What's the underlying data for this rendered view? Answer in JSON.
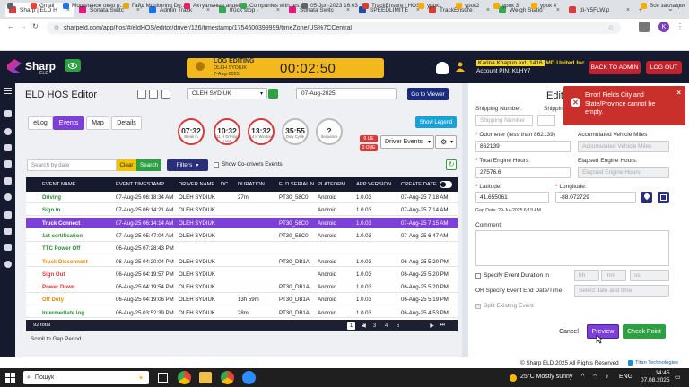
{
  "browser": {
    "tabs": [
      {
        "label": "Sharp | ELD H",
        "active": true,
        "color": "#d73b3b"
      },
      {
        "label": "Sonata Switc",
        "color": "#e31b7c"
      },
      {
        "label": "Admin Track",
        "color": "#1a73e8"
      },
      {
        "label": "truck stop -",
        "color": "#34a853"
      },
      {
        "label": "Sonata Switc",
        "color": "#e31b7c"
      },
      {
        "label": "SPEEDLIMITE",
        "color": "#1f4ea8"
      },
      {
        "label": "TrackEnsure |",
        "color": "#d23f31"
      },
      {
        "label": "Weigh Statio",
        "color": "#34a853"
      },
      {
        "label": "di-Y5FLW.p",
        "color": "#d73b3b"
      }
    ],
    "url": "sharpeld.com/app/hos/#/eldHOS/editor/driver/126/timestamp/1754600399999/timeZone/US%7CCentral",
    "bookmarks": [
      {
        "label": "Gmail",
        "color": "#ea4335"
      },
      {
        "label": "Модальное окно р...",
        "color": "#1a73e8"
      },
      {
        "label": "Гайд Monitoring De...",
        "color": "#e8a317"
      },
      {
        "label": "Актуальные апдейт...",
        "color": "#e91e63"
      },
      {
        "label": "Companies with res...",
        "color": "#34a853"
      },
      {
        "label": "05-Jun-2023 16:03",
        "color": "#5f6368"
      },
      {
        "label": "TrackEnsure | HOS",
        "color": "#d23f31"
      },
      {
        "label": "урок1",
        "color": "#f9ab00"
      },
      {
        "label": "урок2",
        "color": "#f9ab00"
      },
      {
        "label": "урок 3",
        "color": "#f9ab00"
      },
      {
        "label": "урок 4",
        "color": "#f9ab00"
      },
      {
        "label": "Все закладки",
        "color": "#f9ab00"
      }
    ]
  },
  "header": {
    "logo_text": "Sharp",
    "logo_sub": "ELD",
    "timer_title": "LOG EDITING",
    "timer_l1": "OLEH SYDIUK",
    "timer_l2": "7-Aug-2025",
    "timer_value": "00:02:50",
    "user_name": "Karina Khapun ext. 1416",
    "company": "MD United Inc",
    "account_pin": "Account PIN: KLHY7",
    "back_admin": "BACK TO ADMIN",
    "logout": "LOG OUT"
  },
  "editor": {
    "title": "ELD HOS Editor",
    "driver": "OLEH SYDIUK",
    "date": "07-Aug-2025",
    "goto_viewer": "Go to Viewer",
    "tabs": [
      "eLog",
      "Events",
      "Map",
      "Details"
    ],
    "active_tab": "Events",
    "clocks": [
      {
        "time": "07:32",
        "label": "Break in"
      },
      {
        "time": "10:32",
        "label": "11 H Driving Limit"
      },
      {
        "time": "13:32",
        "label": "14 H Window"
      },
      {
        "time": "35:55",
        "label": "Duty Cycle"
      },
      {
        "time": "?",
        "label": "Sequence"
      }
    ],
    "show_legend": "Show Legend",
    "badge_ue": "0 UE",
    "badge_oue": "0 OUE",
    "driver_events": "Driver Events",
    "search_placeholder": "Search by date",
    "clear": "Clear",
    "search": "Search",
    "filters": "Filters",
    "show_codrivers": "Show Co-drivers Events",
    "columns": [
      "EVENT NAME",
      "EVENT TIMESTAMP",
      "DRIVER NAME",
      "DC",
      "DURATION",
      "ELD SERIAL N",
      "PLATFORM",
      "APP VERSION",
      "CREATE DATE"
    ],
    "rows": [
      {
        "event": "Driving",
        "color": "#2e8b3a",
        "ts": "07-Aug-25 06:18:34 AM",
        "driver": "OLEH SYDIUK",
        "dur": "27m",
        "serial": "PT30_58C0",
        "platform": "Android",
        "app": "1.0.03",
        "create": "07-Aug-25 7:18 AM"
      },
      {
        "event": "Sign In",
        "color": "#2e8b3a",
        "ts": "07-Aug-25 06:14:21 AM",
        "driver": "OLEH SYDIUK",
        "dur": "",
        "serial": "",
        "platform": "Android",
        "app": "1.0.03",
        "create": "07-Aug-25 7:14 AM"
      },
      {
        "event": "Truck Connect",
        "color": "#ffffff",
        "ts": "07-Aug-25 06:14:14 AM",
        "driver": "OLEH SYDIUK",
        "dur": "",
        "serial": "PT30_58C0",
        "platform": "Android",
        "app": "1.0.03",
        "create": "07-Aug-25 7:15 AM",
        "selected": true
      },
      {
        "event": "1st certification",
        "color": "#2e8b3a",
        "ts": "07-Aug-25 05:47:04 AM",
        "driver": "OLEH SYDIUK",
        "dur": "",
        "serial": "PT30_58C0",
        "platform": "Android",
        "app": "1.0.03",
        "create": "07-Aug-25 6:47 AM"
      },
      {
        "event": "TTC Power Off",
        "color": "#2e8b3a",
        "ts": "06-Aug-25 07:28:43 PM",
        "driver": "",
        "dur": "",
        "serial": "",
        "platform": "",
        "app": "",
        "create": ""
      },
      {
        "event": "Truck Disconnect",
        "color": "#e08a00",
        "ts": "06-Aug-25 04:20:04 PM",
        "driver": "OLEH SYDIUK",
        "dur": "",
        "serial": "PT30_DB1A",
        "platform": "Android",
        "app": "1.0.03",
        "create": "06-Aug-25 5:20 PM"
      },
      {
        "event": "Sign Out",
        "color": "#d73b3b",
        "ts": "06-Aug-25 04:19:57 PM",
        "driver": "OLEH SYDIUK",
        "dur": "",
        "serial": "",
        "platform": "Android",
        "app": "1.0.03",
        "create": "06-Aug-25 5:20 PM"
      },
      {
        "event": "Power Down",
        "color": "#d73b3b",
        "ts": "06-Aug-25 04:19:54 PM",
        "driver": "OLEH SYDIUK",
        "dur": "",
        "serial": "PT30_DB1A",
        "platform": "Android",
        "app": "1.0.03",
        "create": "06-Aug-25 5:20 PM"
      },
      {
        "event": "Off Duty",
        "color": "#e08a00",
        "ts": "06-Aug-25 04:19:06 PM",
        "driver": "OLEH SYDIUK",
        "dur": "13h 59m",
        "serial": "PT30_DB1A",
        "platform": "Android",
        "app": "1.0.03",
        "create": "06-Aug-25 5:19 PM"
      },
      {
        "event": "Intermediate log",
        "color": "#2e8b3a",
        "ts": "06-Aug-25 03:52:39 PM",
        "driver": "OLEH SYDIUK",
        "dur": "28m",
        "serial": "PT30_DB1A",
        "platform": "Android",
        "app": "1.0.03",
        "create": "06-Aug-25 4:53 PM"
      }
    ],
    "total": "92 total",
    "pages": [
      "1",
      "2",
      "3",
      "4",
      "5"
    ],
    "current_page": "1",
    "scroll_gap": "Scroll to Gap Period"
  },
  "panel": {
    "title": "Edit",
    "shipping_number_label": "Shipping Number:",
    "shipping_number_ph": "Shipping Number",
    "shipping_label2": "Shippin",
    "odometer_label": "Odometer (less than 862139)",
    "odometer": "862139",
    "acc_miles_label": "Accumulated Vehicle Miles",
    "acc_miles_ph": "Accumulated Vehicle Miles",
    "engine_hours_label": "Total Engine Hours:",
    "engine_hours": "27576.6",
    "elapsed_label": "Elapsed Engine Hours:",
    "elapsed_ph": "Elapsed Engine Hours",
    "lat_label": "Latitude:",
    "lat": "41.655061",
    "lon_label": "Longitude:",
    "lon": "-88.072729",
    "gap_date": "Gap Date: 29-Jul-2025 6:19 AM",
    "comment_label": "Comment:",
    "specify_duration": "Specify Event Duration in",
    "hh": "hh",
    "mm": "mm",
    "ss": "ss",
    "or_specify": "OR Specify Event End Date/Time",
    "date_time_ph": "Select date and time",
    "split": "Split Existing Event",
    "cancel": "Cancel",
    "preview": "Preview",
    "checkpoint": "Check Point"
  },
  "toast": {
    "message": "Error! Fields City and State/Province cannot be empty."
  },
  "footer": {
    "copyright": "© Sharp ELD 2025 All Rights Reserved",
    "brand": "Titan Technologies"
  },
  "taskbar": {
    "search_placeholder": "Пошук",
    "weather": "25°C Mostly sunny",
    "lang": "ENG",
    "time": "14:45",
    "date": "07.08.2025"
  }
}
